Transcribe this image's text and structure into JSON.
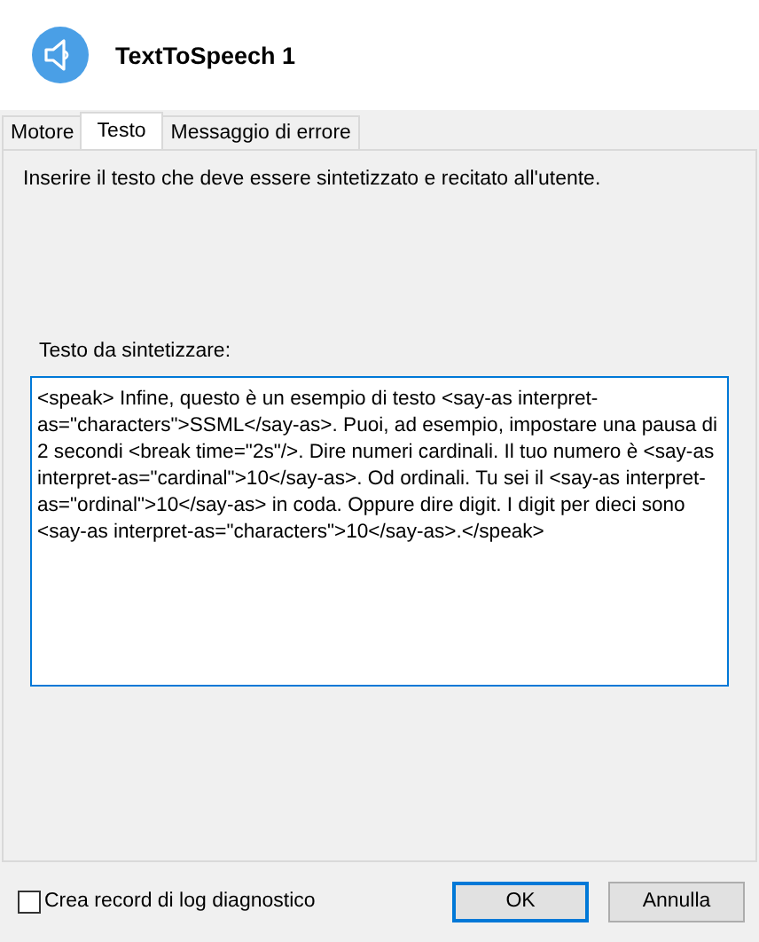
{
  "header": {
    "title": "TextToSpeech 1"
  },
  "tabs": [
    {
      "label": "Motore",
      "selected": false
    },
    {
      "label": "Testo",
      "selected": true
    },
    {
      "label": "Messaggio di errore",
      "selected": false
    }
  ],
  "instructions": "Inserire il testo che deve essere sintetizzato e recitato all'utente.",
  "text_field": {
    "label": "Testo da sintetizzare:",
    "value": "<speak> Infine, questo è un esempio di testo <say-as interpret-as=\"characters\">SSML</say-as>. Puoi, ad esempio, impostare una pausa di 2 secondi <break time=\"2s\"/>. Dire numeri cardinali. Il tuo numero è <say-as interpret-as=\"cardinal\">10</say-as>. Od ordinali. Tu sei il <say-as interpret-as=\"ordinal\">10</say-as> in coda. Oppure dire digit. I digit per dieci sono <say-as interpret-as=\"characters\">10</say-as>.</speak>"
  },
  "log_checkbox": {
    "label": "Crea record di log diagnostico",
    "checked": false
  },
  "buttons": [
    {
      "label": "OK",
      "default": true
    },
    {
      "label": "Annulla",
      "default": false
    }
  ]
}
